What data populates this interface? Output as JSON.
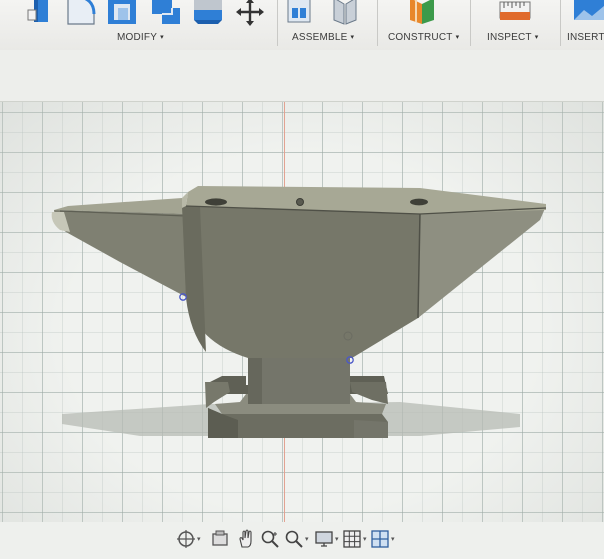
{
  "toolbar": {
    "groups": [
      {
        "label": "MODIFY",
        "caret": "▾"
      },
      {
        "label": "ASSEMBLE",
        "caret": "▾"
      },
      {
        "label": "CONSTRUCT",
        "caret": "▾"
      },
      {
        "label": "INSPECT",
        "caret": "▾"
      },
      {
        "label": "INSERT"
      }
    ],
    "buttons": [
      "press-pull-icon",
      "fillet-icon",
      "shell-icon",
      "combine-icon",
      "scale-icon",
      "move-copy-icon",
      "new-component-icon",
      "joint-icon",
      "offset-plane-icon",
      "measure-icon",
      "insert-image-icon"
    ]
  },
  "viewport": {
    "model": "anvil",
    "colors": {
      "body": "#7b7c6f",
      "face_light": "#8d8e80",
      "face_dark": "#67685c",
      "shadow": "#b9bdb6",
      "grid": "#a0b0aa",
      "axis": "#e2a392"
    }
  },
  "navbar": {
    "controls": [
      {
        "icon": "orbit-icon",
        "has_dropdown": true
      },
      {
        "icon": "look-at-icon",
        "has_dropdown": false
      },
      {
        "icon": "pan-icon",
        "has_dropdown": false
      },
      {
        "icon": "zoom-icon",
        "has_dropdown": false
      },
      {
        "icon": "fit-window-icon",
        "has_dropdown": true
      },
      {
        "icon": "display-settings-icon",
        "has_dropdown": true
      },
      {
        "icon": "grid-settings-icon",
        "has_dropdown": true
      },
      {
        "icon": "viewports-icon",
        "has_dropdown": true
      }
    ],
    "dropdown_caret": "▾"
  }
}
